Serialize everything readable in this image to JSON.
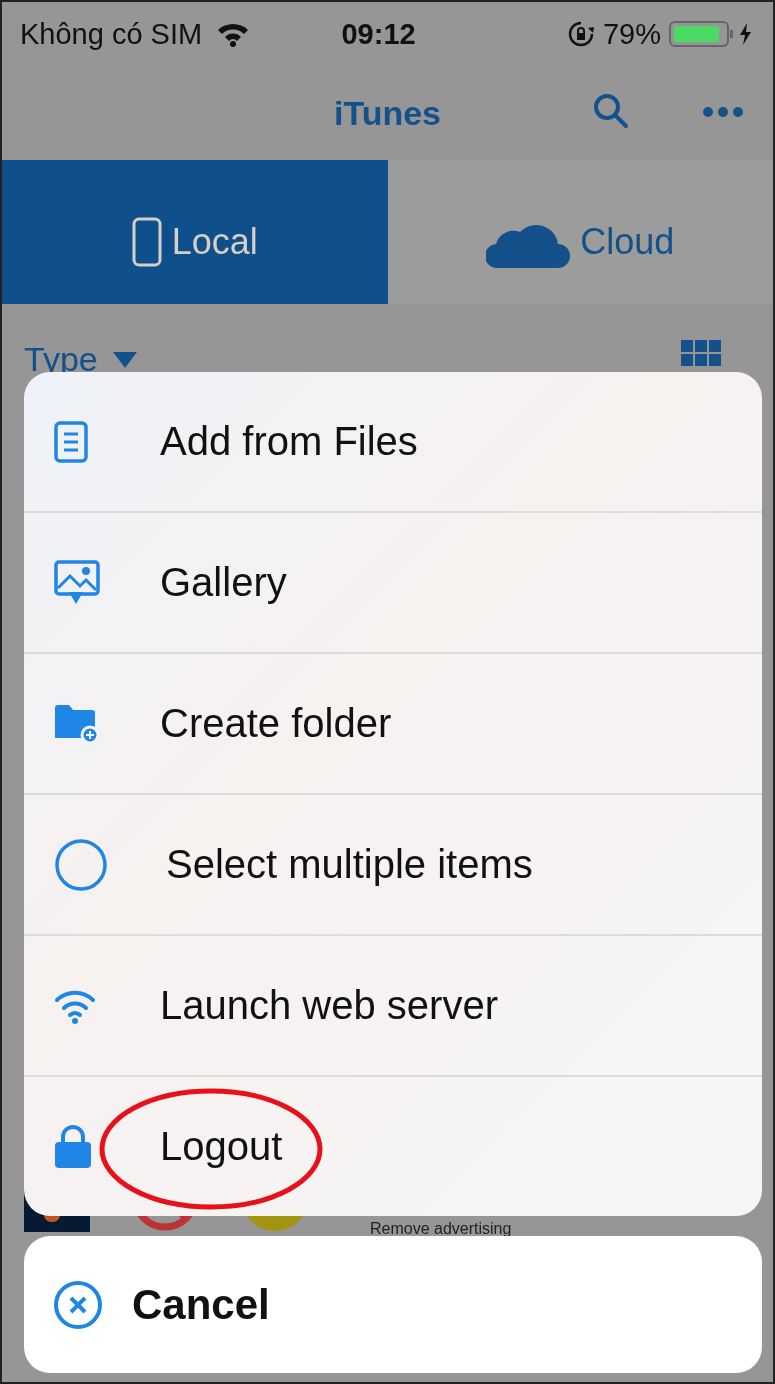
{
  "status_bar": {
    "carrier": "Không có SIM",
    "time": "09:12",
    "battery": "79%"
  },
  "nav": {
    "title": "iTunes"
  },
  "tabs": [
    {
      "label": "Local",
      "kind": "device",
      "selected": true
    },
    {
      "label": "Cloud",
      "kind": "cloud",
      "selected": false
    }
  ],
  "sort": {
    "label": "Type"
  },
  "ad": {
    "text": "Remove advertising"
  },
  "menu": {
    "items": [
      {
        "label": "Add from Files",
        "kind": "document",
        "circled": false
      },
      {
        "label": "Gallery",
        "kind": "gallery",
        "circled": false
      },
      {
        "label": "Create folder",
        "kind": "folder",
        "circled": false
      },
      {
        "label": "Select multiple items",
        "kind": "select",
        "circled": false
      },
      {
        "label": "Launch web server",
        "kind": "wifi",
        "circled": false
      },
      {
        "label": "Logout",
        "kind": "lock",
        "circled": true
      }
    ]
  },
  "cancel": {
    "label": "Cancel"
  }
}
